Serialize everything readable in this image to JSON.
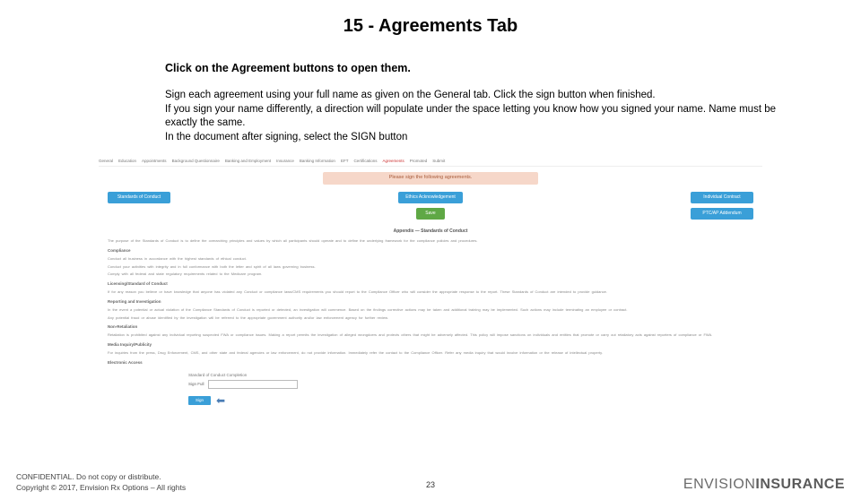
{
  "title": "15 - Agreements Tab",
  "subtitle": "Click on the Agreement buttons to open them.",
  "body": {
    "p1": "Sign each agreement using your full name as given on the General tab.  Click the sign button when finished.",
    "p2": "If you sign your name differently, a direction will populate under the space letting you know how you signed your name. Name must be exactly the same.",
    "p3": "In the document after signing, select the SIGN button"
  },
  "shot": {
    "tabs": [
      "General",
      "Education",
      "Appointments",
      "Background Questionnaire",
      "Banking and Employment",
      "Insurance",
      "Banking Information",
      "EFT",
      "Certifications",
      "Agreements",
      "Promoted",
      "Submit"
    ],
    "active_tab_index": 9,
    "banner": "Please sign the following agreements.",
    "buttons": {
      "left": "Standards of Conduct",
      "center": "Ethics Acknowledgement",
      "right_top": "Individual Contract",
      "right_bottom": "PTC/AP Addendum",
      "save": "Save"
    },
    "doc_title": "Appendix — Standards of Conduct",
    "sections": [
      "Compliance",
      "Licensing/Standard of Conduct",
      "Reporting and Investigation",
      "Non-Retaliation",
      "Media Inquiry/Publicity",
      "Electronic Access"
    ],
    "sign_label": "Standard of Conduct Completion",
    "sign_placeholder_label": "Sign Full",
    "sign_btn": "Sign"
  },
  "footer": {
    "conf": "CONFIDENTIAL. Do not copy or distribute.",
    "copy": "Copyright © 2017, Envision Rx Options – All rights",
    "page": "23",
    "brand_a": "ENVISION",
    "brand_b": "INSURANCE"
  }
}
